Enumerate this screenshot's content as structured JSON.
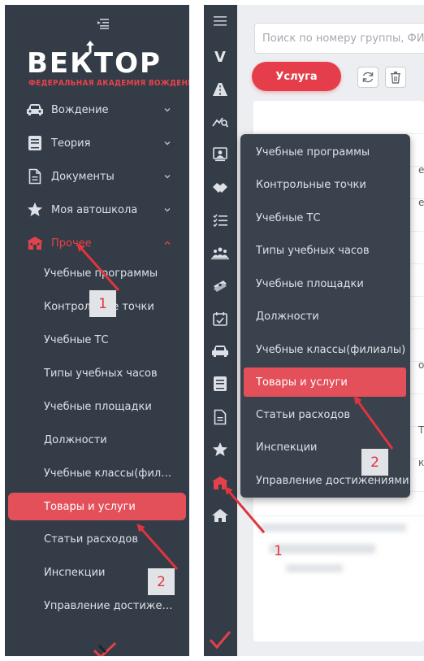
{
  "left_sidebar": {
    "logo": {
      "word": "ВЕКТОР",
      "subtitle": "ФЕДЕРАЛЬНАЯ АКАДЕМИЯ ВОЖДЕНИЯ"
    },
    "menu": [
      {
        "label": "Вождение",
        "icon": "car-icon",
        "expanded": false
      },
      {
        "label": "Теория",
        "icon": "book-icon",
        "expanded": false
      },
      {
        "label": "Документы",
        "icon": "document-icon",
        "expanded": false
      },
      {
        "label": "Моя автошкола",
        "icon": "star-icon",
        "expanded": false
      },
      {
        "label": "Прочее",
        "icon": "school-icon",
        "expanded": true,
        "active": true
      }
    ],
    "submenu": [
      {
        "label": "Учебные программы"
      },
      {
        "label": "Контрольные точки"
      },
      {
        "label": "Учебные ТС"
      },
      {
        "label": "Типы учебных часов"
      },
      {
        "label": "Учебные площадки"
      },
      {
        "label": "Должности"
      },
      {
        "label": "Учебные классы(филиалы)"
      },
      {
        "label": "Товары и услуги",
        "selected": true
      },
      {
        "label": "Статьи расходов"
      },
      {
        "label": "Инспекции"
      },
      {
        "label": "Управление достижениями"
      }
    ]
  },
  "right_view": {
    "rail_letter": "V",
    "rail_icons": [
      "menu-icon",
      "v-logo-icon",
      "road-icon",
      "chart-icon",
      "instructor-icon",
      "handshake-icon",
      "checklist-icon",
      "group-icon",
      "money-icon",
      "calendar-icon",
      "car-icon",
      "book-icon",
      "document-icon",
      "star-icon",
      "school-icon",
      "home-icon"
    ],
    "search": {
      "placeholder": "Поиск по номеру группы, ФИО"
    },
    "service_button": "Услуга",
    "toolbar": {
      "refresh_icon": "refresh-icon",
      "delete_icon": "trash-icon"
    },
    "edge_chars": [
      "е",
      "е",
      "о",
      "Т",
      "к"
    ],
    "flyout": [
      {
        "label": "Учебные программы"
      },
      {
        "label": "Контрольные точки"
      },
      {
        "label": "Учебные ТС"
      },
      {
        "label": "Типы учебных часов"
      },
      {
        "label": "Учебные площадки"
      },
      {
        "label": "Должности"
      },
      {
        "label": "Учебные классы(филиалы)"
      },
      {
        "label": "Товары и услуги",
        "selected": true
      },
      {
        "label": "Статьи расходов"
      },
      {
        "label": "Инспекции"
      },
      {
        "label": "Управление достижениями"
      }
    ]
  },
  "annotations": {
    "left_step1": "1",
    "left_step2": "2",
    "right_step1": "1",
    "right_step2": "2",
    "arrow_color": "#e0353f"
  },
  "colors": {
    "sidebar_bg": "#343c47",
    "accent": "#e4505a",
    "text": "#dde1e7"
  }
}
